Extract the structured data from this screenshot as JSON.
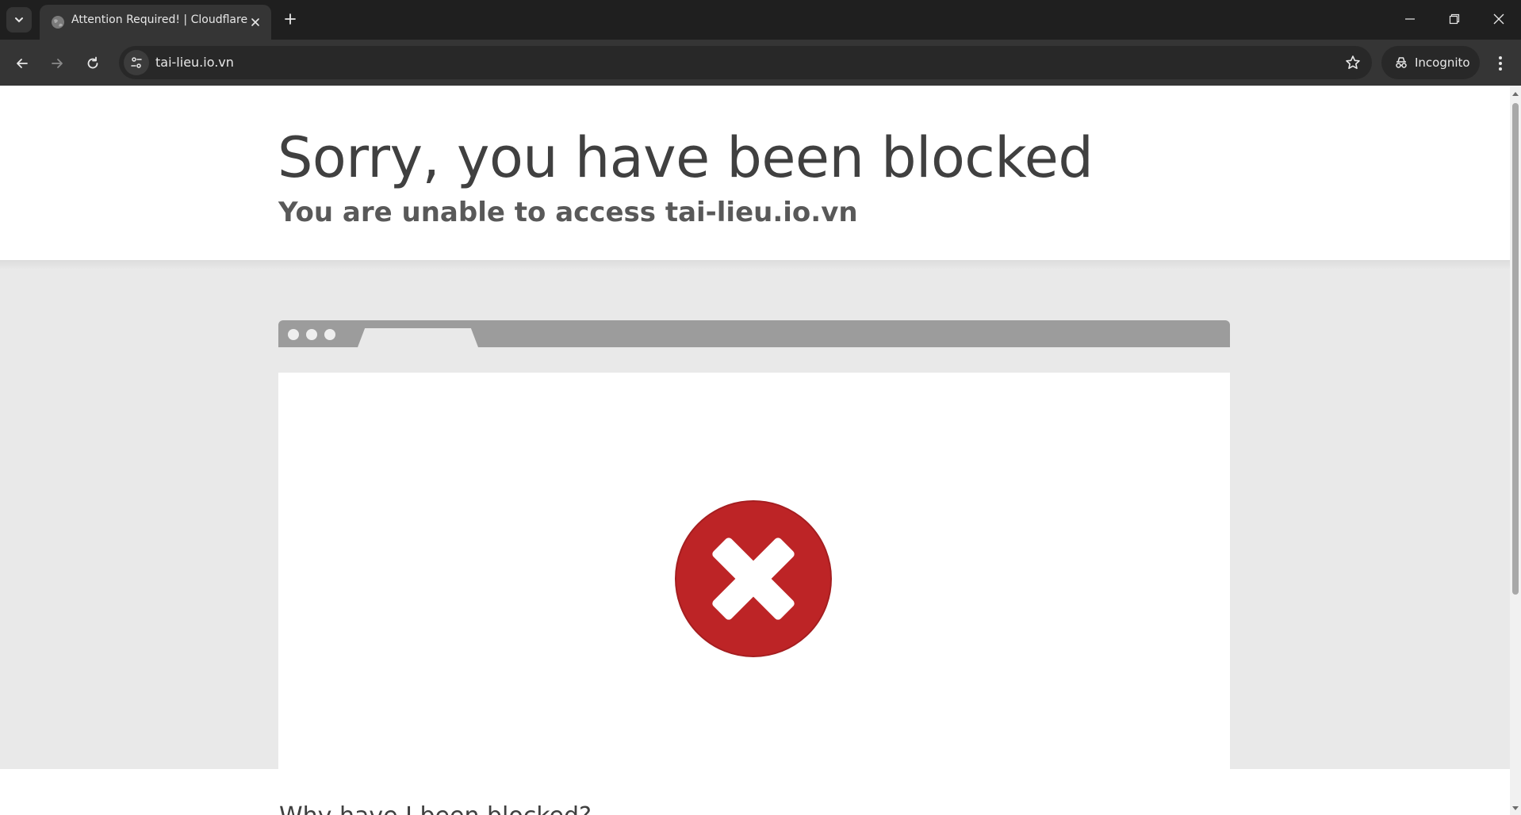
{
  "browser": {
    "tab": {
      "title": "Attention Required! | Cloudflare"
    },
    "address_bar": {
      "url": "tai-lieu.io.vn"
    },
    "profile": {
      "label": "Incognito"
    }
  },
  "page": {
    "heading": "Sorry, you have been blocked",
    "subheading": "You are unable to access tai-lieu.io.vn",
    "error_icon_color": "#bd2426",
    "below_fold_text": "Why have I been blocked?"
  },
  "colors": {
    "tabstrip": "#1f1f1f",
    "toolbar": "#353535",
    "page_gray": "#e9e9e9"
  }
}
